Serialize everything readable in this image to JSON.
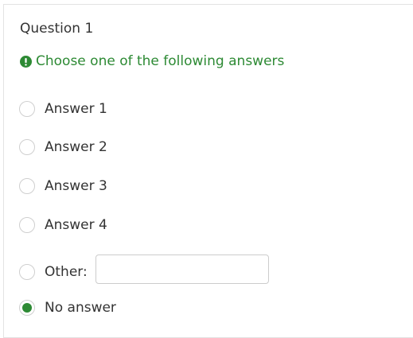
{
  "question": {
    "title": "Question 1",
    "tip": "Choose one of the following answers",
    "tip_icon": "exclamation-circle-icon",
    "accent_color": "#2d8a34"
  },
  "options": [
    {
      "label": "Answer 1",
      "checked": false
    },
    {
      "label": "Answer 2",
      "checked": false
    },
    {
      "label": "Answer 3",
      "checked": false
    },
    {
      "label": "Answer 4",
      "checked": false
    },
    {
      "label": "Other:",
      "checked": false
    },
    {
      "label": "No answer",
      "checked": true
    }
  ],
  "other_input": {
    "value": "",
    "placeholder": ""
  }
}
